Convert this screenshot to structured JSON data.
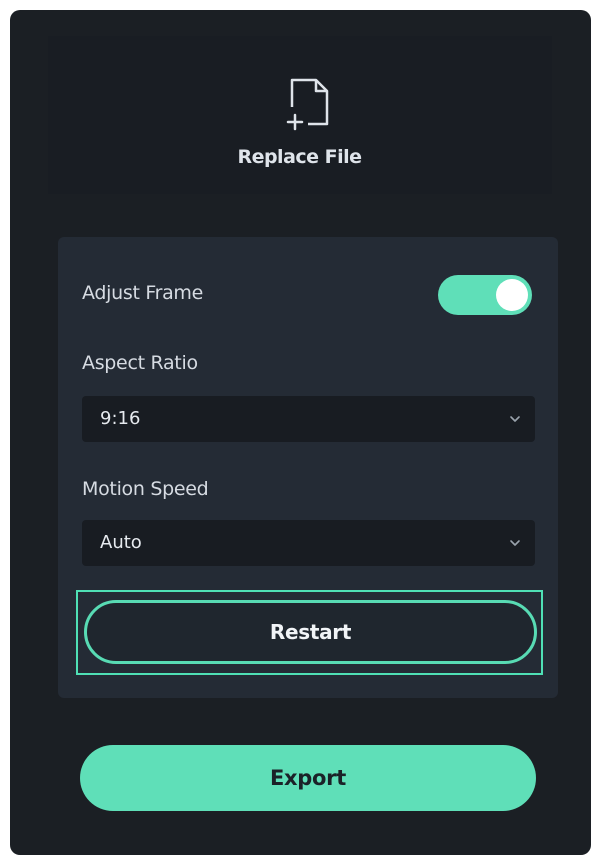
{
  "replace": {
    "label": "Replace File",
    "icon": "replace-file-icon"
  },
  "adjust_frame": {
    "label": "Adjust Frame",
    "enabled": true
  },
  "aspect_ratio": {
    "label": "Aspect Ratio",
    "value": "9:16"
  },
  "motion_speed": {
    "label": "Motion Speed",
    "value": "Auto"
  },
  "buttons": {
    "restart": "Restart",
    "export": "Export"
  },
  "colors": {
    "accent": "#5fdfb8",
    "panel": "#1b1f24",
    "card": "#242b35",
    "field": "#181c22"
  }
}
